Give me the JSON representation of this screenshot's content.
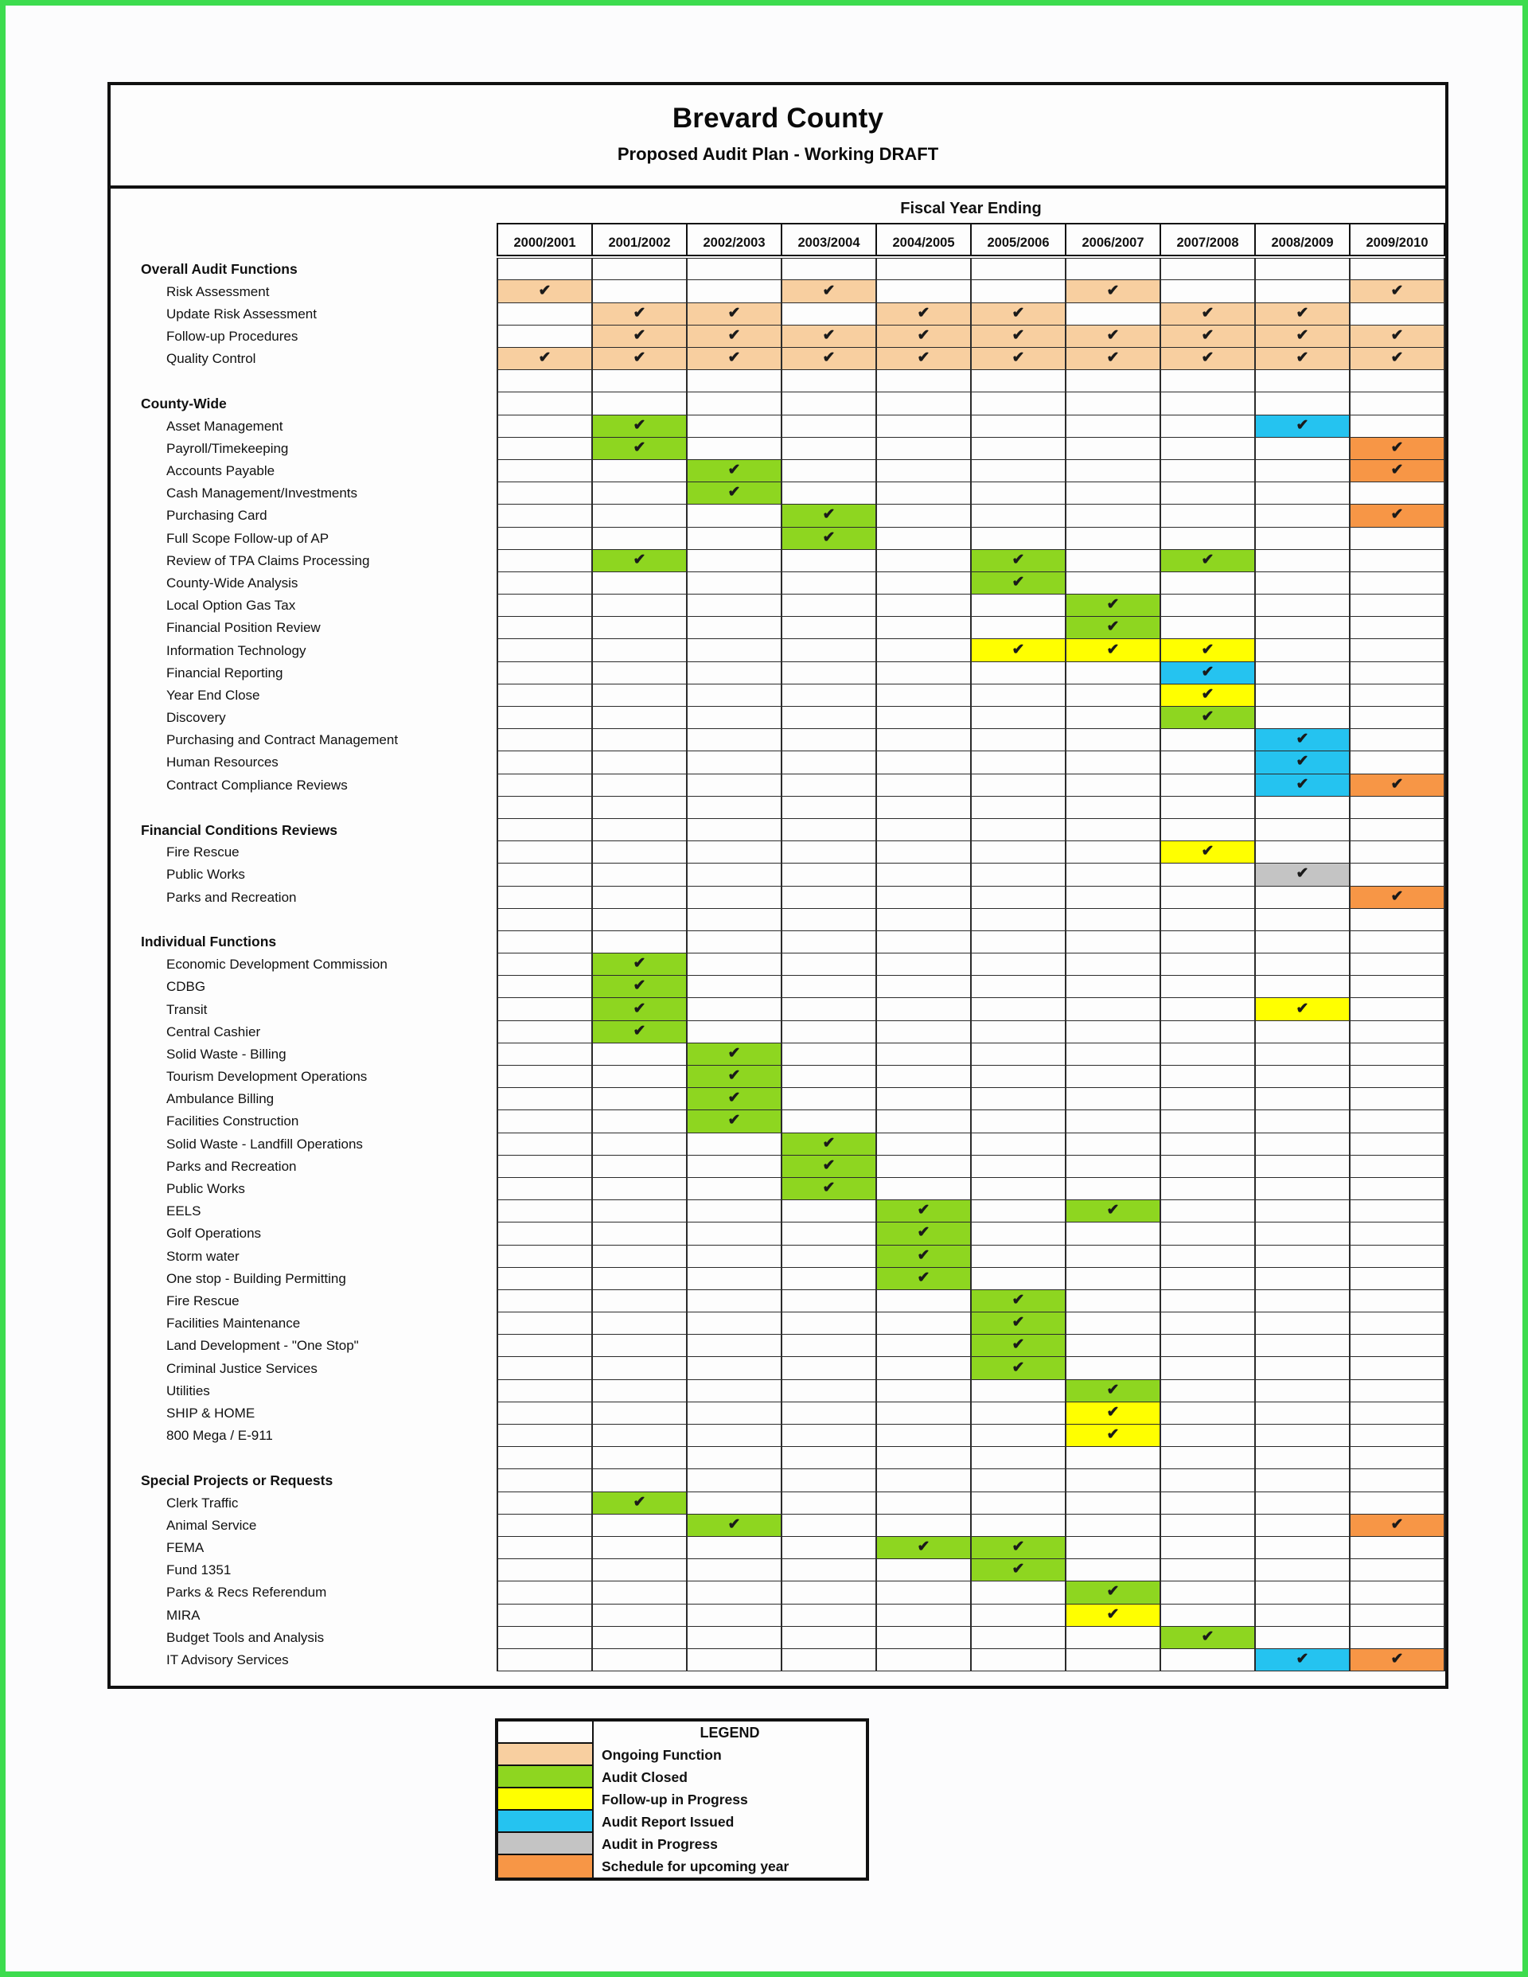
{
  "document": {
    "title_main": "Brevard County",
    "title_sub": "Proposed Audit Plan - Working DRAFT"
  },
  "table": {
    "column_group_header": "Fiscal Year Ending",
    "columns": [
      "2000/2001",
      "2001/2002",
      "2002/2003",
      "2003/2004",
      "2004/2005",
      "2005/2006",
      "2006/2007",
      "2007/2008",
      "2008/2009",
      "2009/2010"
    ],
    "check_glyph": "✔",
    "status_colors": {
      "ongoing": "#f8cfa0",
      "closed": "#8ed620",
      "followup": "#ffff00",
      "issued": "#25c3f0",
      "in_progress": "#c4c4c4",
      "upcoming": "#f79646"
    },
    "rows": [
      {
        "type": "section",
        "label": "Overall Audit Functions",
        "cells": [
          "",
          "",
          "",
          "",
          "",
          "",
          "",
          "",
          "",
          ""
        ]
      },
      {
        "type": "item",
        "label": "Risk Assessment",
        "cells": [
          "peach",
          "",
          "",
          "peach",
          "",
          "",
          "peach",
          "",
          "",
          "peach"
        ]
      },
      {
        "type": "item",
        "label": "Update Risk Assessment",
        "cells": [
          "",
          "peach",
          "peach",
          "",
          "peach",
          "peach",
          "",
          "peach",
          "peach",
          ""
        ]
      },
      {
        "type": "item",
        "label": "Follow-up Procedures",
        "cells": [
          "",
          "peach",
          "peach",
          "peach",
          "peach",
          "peach",
          "peach",
          "peach",
          "peach",
          "peach"
        ]
      },
      {
        "type": "item",
        "label": "Quality Control",
        "cells": [
          "peach",
          "peach",
          "peach",
          "peach",
          "peach",
          "peach",
          "peach",
          "peach",
          "peach",
          "peach"
        ]
      },
      {
        "type": "blank",
        "label": "",
        "cells": [
          "",
          "",
          "",
          "",
          "",
          "",
          "",
          "",
          "",
          ""
        ]
      },
      {
        "type": "section",
        "label": "County-Wide",
        "cells": [
          "",
          "",
          "",
          "",
          "",
          "",
          "",
          "",
          "",
          ""
        ]
      },
      {
        "type": "item",
        "label": "Asset Management",
        "cells": [
          "",
          "closed",
          "",
          "",
          "",
          "",
          "",
          "",
          "issued",
          ""
        ]
      },
      {
        "type": "item",
        "label": "Payroll/Timekeeping",
        "cells": [
          "",
          "closed",
          "",
          "",
          "",
          "",
          "",
          "",
          "",
          "upcoming"
        ]
      },
      {
        "type": "item",
        "label": "Accounts Payable",
        "cells": [
          "",
          "",
          "closed",
          "",
          "",
          "",
          "",
          "",
          "",
          "upcoming"
        ]
      },
      {
        "type": "item",
        "label": "Cash Management/Investments",
        "cells": [
          "",
          "",
          "closed",
          "",
          "",
          "",
          "",
          "",
          "",
          ""
        ]
      },
      {
        "type": "item",
        "label": "Purchasing Card",
        "cells": [
          "",
          "",
          "",
          "closed",
          "",
          "",
          "",
          "",
          "",
          "upcoming"
        ]
      },
      {
        "type": "item",
        "label": "Full Scope Follow-up of AP",
        "cells": [
          "",
          "",
          "",
          "closed",
          "",
          "",
          "",
          "",
          "",
          ""
        ]
      },
      {
        "type": "item",
        "label": "Review of TPA Claims Processing",
        "cells": [
          "",
          "closed",
          "",
          "",
          "",
          "closed",
          "",
          "closed",
          "",
          ""
        ]
      },
      {
        "type": "item",
        "label": "County-Wide Analysis",
        "cells": [
          "",
          "",
          "",
          "",
          "",
          "closed",
          "",
          "",
          "",
          ""
        ]
      },
      {
        "type": "item",
        "label": "Local Option Gas Tax",
        "cells": [
          "",
          "",
          "",
          "",
          "",
          "",
          "closed",
          "",
          "",
          ""
        ]
      },
      {
        "type": "item",
        "label": "Financial Position Review",
        "cells": [
          "",
          "",
          "",
          "",
          "",
          "",
          "closed",
          "",
          "",
          ""
        ]
      },
      {
        "type": "item",
        "label": "Information Technology",
        "cells": [
          "",
          "",
          "",
          "",
          "",
          "followup",
          "followup",
          "followup",
          "",
          ""
        ]
      },
      {
        "type": "item",
        "label": "Financial Reporting",
        "cells": [
          "",
          "",
          "",
          "",
          "",
          "",
          "",
          "issued",
          "",
          ""
        ]
      },
      {
        "type": "item",
        "label": "Year End Close",
        "cells": [
          "",
          "",
          "",
          "",
          "",
          "",
          "",
          "followup",
          "",
          ""
        ]
      },
      {
        "type": "item",
        "label": "Discovery",
        "cells": [
          "",
          "",
          "",
          "",
          "",
          "",
          "",
          "closed",
          "",
          ""
        ]
      },
      {
        "type": "item",
        "label": "Purchasing and Contract Management",
        "cells": [
          "",
          "",
          "",
          "",
          "",
          "",
          "",
          "",
          "issued",
          ""
        ]
      },
      {
        "type": "item",
        "label": "Human Resources",
        "cells": [
          "",
          "",
          "",
          "",
          "",
          "",
          "",
          "",
          "issued",
          ""
        ]
      },
      {
        "type": "item",
        "label": "Contract Compliance Reviews",
        "cells": [
          "",
          "",
          "",
          "",
          "",
          "",
          "",
          "",
          "issued",
          "upcoming"
        ]
      },
      {
        "type": "blank",
        "label": "",
        "cells": [
          "",
          "",
          "",
          "",
          "",
          "",
          "",
          "",
          "",
          ""
        ]
      },
      {
        "type": "section",
        "label": "Financial Conditions Reviews",
        "cells": [
          "",
          "",
          "",
          "",
          "",
          "",
          "",
          "",
          "",
          ""
        ]
      },
      {
        "type": "item",
        "label": "Fire Rescue",
        "cells": [
          "",
          "",
          "",
          "",
          "",
          "",
          "",
          "followup",
          "",
          ""
        ]
      },
      {
        "type": "item",
        "label": "Public Works",
        "cells": [
          "",
          "",
          "",
          "",
          "",
          "",
          "",
          "",
          "in_progress",
          ""
        ]
      },
      {
        "type": "item",
        "label": "Parks and Recreation",
        "cells": [
          "",
          "",
          "",
          "",
          "",
          "",
          "",
          "",
          "",
          "upcoming"
        ]
      },
      {
        "type": "blank",
        "label": "",
        "cells": [
          "",
          "",
          "",
          "",
          "",
          "",
          "",
          "",
          "",
          ""
        ]
      },
      {
        "type": "section",
        "label": "Individual Functions",
        "cells": [
          "",
          "",
          "",
          "",
          "",
          "",
          "",
          "",
          "",
          ""
        ]
      },
      {
        "type": "item",
        "label": "Economic Development Commission",
        "cells": [
          "",
          "closed",
          "",
          "",
          "",
          "",
          "",
          "",
          "",
          ""
        ]
      },
      {
        "type": "item",
        "label": "CDBG",
        "cells": [
          "",
          "closed",
          "",
          "",
          "",
          "",
          "",
          "",
          "",
          ""
        ]
      },
      {
        "type": "item",
        "label": "Transit",
        "cells": [
          "",
          "closed",
          "",
          "",
          "",
          "",
          "",
          "",
          "followup",
          ""
        ]
      },
      {
        "type": "item",
        "label": "Central Cashier",
        "cells": [
          "",
          "closed",
          "",
          "",
          "",
          "",
          "",
          "",
          "",
          ""
        ]
      },
      {
        "type": "item",
        "label": "Solid Waste - Billing",
        "cells": [
          "",
          "",
          "closed",
          "",
          "",
          "",
          "",
          "",
          "",
          ""
        ]
      },
      {
        "type": "item",
        "label": "Tourism Development Operations",
        "cells": [
          "",
          "",
          "closed",
          "",
          "",
          "",
          "",
          "",
          "",
          ""
        ]
      },
      {
        "type": "item",
        "label": "Ambulance Billing",
        "cells": [
          "",
          "",
          "closed",
          "",
          "",
          "",
          "",
          "",
          "",
          ""
        ]
      },
      {
        "type": "item",
        "label": "Facilities Construction",
        "cells": [
          "",
          "",
          "closed",
          "",
          "",
          "",
          "",
          "",
          "",
          ""
        ]
      },
      {
        "type": "item",
        "label": "Solid Waste - Landfill Operations",
        "cells": [
          "",
          "",
          "",
          "closed",
          "",
          "",
          "",
          "",
          "",
          ""
        ]
      },
      {
        "type": "item",
        "label": "Parks and Recreation",
        "cells": [
          "",
          "",
          "",
          "closed",
          "",
          "",
          "",
          "",
          "",
          ""
        ]
      },
      {
        "type": "item",
        "label": "Public Works",
        "cells": [
          "",
          "",
          "",
          "closed",
          "",
          "",
          "",
          "",
          "",
          ""
        ]
      },
      {
        "type": "item",
        "label": "EELS",
        "cells": [
          "",
          "",
          "",
          "",
          "closed",
          "",
          "closed",
          "",
          "",
          ""
        ]
      },
      {
        "type": "item",
        "label": "Golf Operations",
        "cells": [
          "",
          "",
          "",
          "",
          "closed",
          "",
          "",
          "",
          "",
          ""
        ]
      },
      {
        "type": "item",
        "label": "Storm water",
        "cells": [
          "",
          "",
          "",
          "",
          "closed",
          "",
          "",
          "",
          "",
          ""
        ]
      },
      {
        "type": "item",
        "label": "One stop - Building Permitting",
        "cells": [
          "",
          "",
          "",
          "",
          "closed",
          "",
          "",
          "",
          "",
          ""
        ]
      },
      {
        "type": "item",
        "label": "Fire Rescue",
        "cells": [
          "",
          "",
          "",
          "",
          "",
          "closed",
          "",
          "",
          "",
          ""
        ]
      },
      {
        "type": "item",
        "label": "Facilities Maintenance",
        "cells": [
          "",
          "",
          "",
          "",
          "",
          "closed",
          "",
          "",
          "",
          ""
        ]
      },
      {
        "type": "item",
        "label": "Land Development - \"One Stop\"",
        "cells": [
          "",
          "",
          "",
          "",
          "",
          "closed",
          "",
          "",
          "",
          ""
        ]
      },
      {
        "type": "item",
        "label": "Criminal Justice Services",
        "cells": [
          "",
          "",
          "",
          "",
          "",
          "closed",
          "",
          "",
          "",
          ""
        ]
      },
      {
        "type": "item",
        "label": "Utilities",
        "cells": [
          "",
          "",
          "",
          "",
          "",
          "",
          "closed",
          "",
          "",
          ""
        ]
      },
      {
        "type": "item",
        "label": "SHIP & HOME",
        "cells": [
          "",
          "",
          "",
          "",
          "",
          "",
          "followup",
          "",
          "",
          ""
        ]
      },
      {
        "type": "item",
        "label": "800 Mega / E-911",
        "cells": [
          "",
          "",
          "",
          "",
          "",
          "",
          "followup",
          "",
          "",
          ""
        ]
      },
      {
        "type": "blank",
        "label": "",
        "cells": [
          "",
          "",
          "",
          "",
          "",
          "",
          "",
          "",
          "",
          ""
        ]
      },
      {
        "type": "section",
        "label": "Special Projects or Requests",
        "cells": [
          "",
          "",
          "",
          "",
          "",
          "",
          "",
          "",
          "",
          ""
        ]
      },
      {
        "type": "item",
        "label": "Clerk Traffic",
        "cells": [
          "",
          "closed",
          "",
          "",
          "",
          "",
          "",
          "",
          "",
          ""
        ]
      },
      {
        "type": "item",
        "label": "Animal Service",
        "cells": [
          "",
          "",
          "closed",
          "",
          "",
          "",
          "",
          "",
          "",
          "upcoming"
        ]
      },
      {
        "type": "item",
        "label": "FEMA",
        "cells": [
          "",
          "",
          "",
          "",
          "closed",
          "closed",
          "",
          "",
          "",
          ""
        ]
      },
      {
        "type": "item",
        "label": "Fund 1351",
        "cells": [
          "",
          "",
          "",
          "",
          "",
          "closed",
          "",
          "",
          "",
          ""
        ]
      },
      {
        "type": "item",
        "label": "Parks & Recs Referendum",
        "cells": [
          "",
          "",
          "",
          "",
          "",
          "",
          "closed",
          "",
          "",
          ""
        ]
      },
      {
        "type": "item",
        "label": "MIRA",
        "cells": [
          "",
          "",
          "",
          "",
          "",
          "",
          "followup",
          "",
          "",
          ""
        ]
      },
      {
        "type": "item",
        "label": "Budget Tools and Analysis",
        "cells": [
          "",
          "",
          "",
          "",
          "",
          "",
          "",
          "closed",
          "",
          ""
        ]
      },
      {
        "type": "item",
        "label": "IT Advisory Services",
        "cells": [
          "",
          "",
          "",
          "",
          "",
          "",
          "",
          "",
          "issued",
          "upcoming"
        ]
      }
    ]
  },
  "legend": {
    "header": "LEGEND",
    "entries": [
      {
        "label": "Ongoing Function",
        "swatch": "peach"
      },
      {
        "label": "Audit Closed",
        "swatch": "green"
      },
      {
        "label": "Follow-up in Progress",
        "swatch": "yellow"
      },
      {
        "label": "Audit Report Issued",
        "swatch": "cyan"
      },
      {
        "label": "Audit in Progress",
        "swatch": "gray"
      },
      {
        "label": "Schedule for upcoming year",
        "swatch": "orange"
      }
    ]
  }
}
